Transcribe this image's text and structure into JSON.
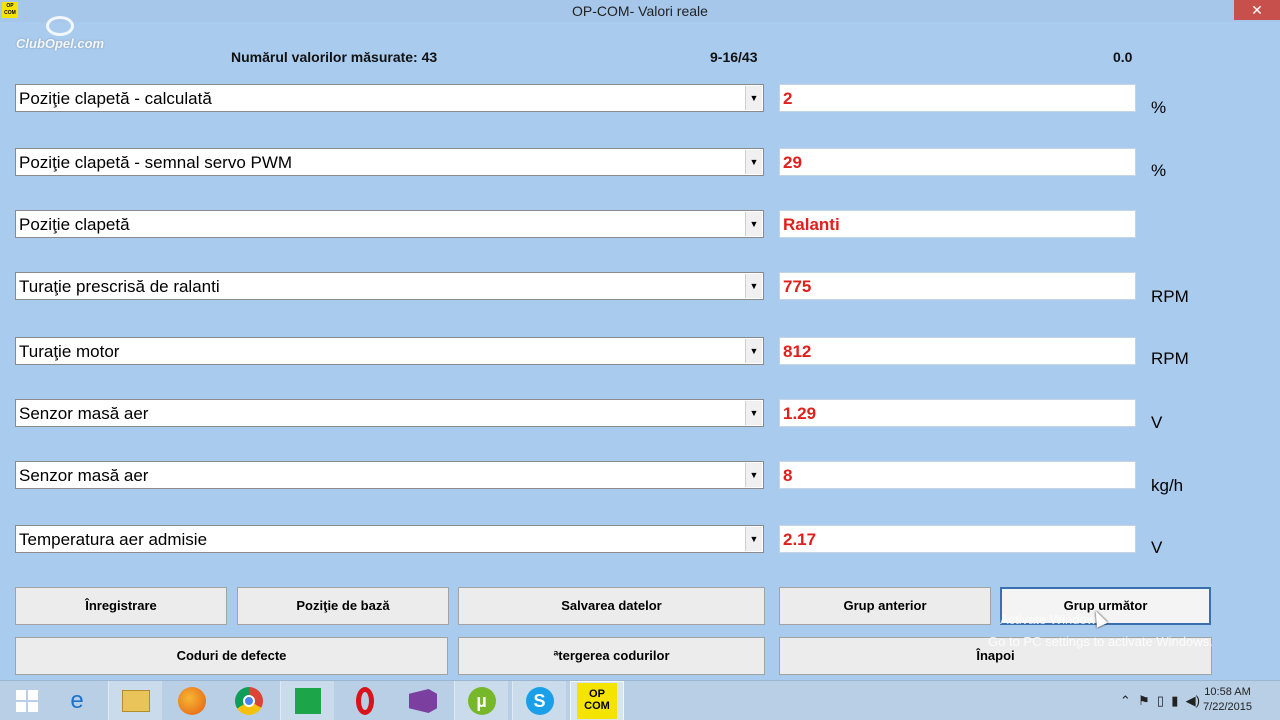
{
  "window": {
    "title": "OP-COM- Valori reale",
    "close_glyph": "✕",
    "app_icon_text": "OP\nCOM"
  },
  "watermark": "ClubOpel.com",
  "header": {
    "count_label": "Numărul valorilor măsurate: 43",
    "range_label": "9-16/43",
    "value_label": "0.0"
  },
  "rows": [
    {
      "label": "Poziţie clapetă - calculată",
      "value": "2",
      "unit": "%"
    },
    {
      "label": "Poziţie clapetă - semnal servo PWM",
      "value": "29",
      "unit": "%"
    },
    {
      "label": "Poziţie clapetă",
      "value": "Ralanti",
      "unit": ""
    },
    {
      "label": "Turaţie prescrisă de ralanti",
      "value": "775",
      "unit": "RPM"
    },
    {
      "label": "Turaţie motor",
      "value": "812",
      "unit": "RPM"
    },
    {
      "label": "Senzor masă aer",
      "value": "1.29",
      "unit": "V"
    },
    {
      "label": "Senzor masă aer",
      "value": "8",
      "unit": "kg/h"
    },
    {
      "label": "Temperatura aer admisie",
      "value": "2.17",
      "unit": "V"
    }
  ],
  "dropdown_arrow": "▼",
  "buttons": {
    "record": "Înregistrare",
    "base_position": "Poziţie de bază",
    "save_data": "Salvarea datelor",
    "prev_group": "Grup anterior",
    "next_group": "Grup următor",
    "fault_codes": "Coduri de defecte",
    "clear_codes": "ªtergerea codurilor",
    "back": "Înapoi"
  },
  "activation": {
    "line1": "Activate Windows",
    "line2": "Go to PC settings to activate Windows."
  },
  "taskbar": {
    "icons": [
      "windows-start-icon",
      "internet-explorer-icon",
      "file-explorer-icon",
      "firefox-icon",
      "chrome-icon",
      "store-icon",
      "opera-icon",
      "visual-studio-icon",
      "utorrent-icon",
      "skype-icon",
      "opcom-icon"
    ],
    "opcom_label": "OP\nCOM",
    "time": "10:58 AM",
    "date": "7/22/2015"
  }
}
